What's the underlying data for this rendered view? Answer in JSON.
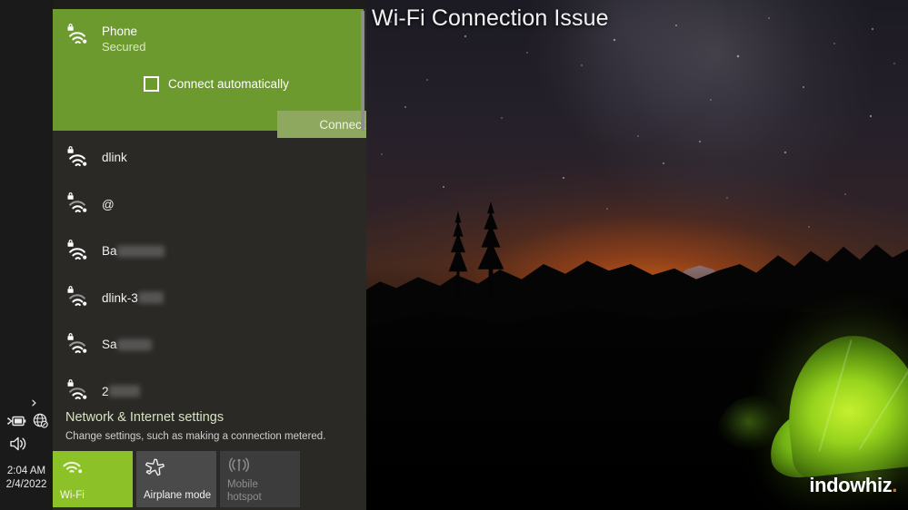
{
  "window": {
    "title": "Wi-Fi Connection Issue",
    "watermark": "indowhiz",
    "watermark_dot": "."
  },
  "colors": {
    "selected_network_green": "#6d9a2e",
    "wifi_tile_green": "#8cc227",
    "panel_dark": "#2b2926",
    "taskbar_dark": "#1a1a1a",
    "connect_button": "#8ea85f",
    "settings_link": "#d6e3c2",
    "watermark_accent": "#f26a21"
  },
  "taskbar": {
    "chevron_icon": "chevron-right-icon",
    "battery_icon": "battery-charging-icon",
    "network_icon": "globe-no-internet-icon",
    "volume_icon": "speaker-volume-icon",
    "clock_time": "2:04 AM",
    "clock_date": "2/4/2022"
  },
  "network_panel": {
    "selected": {
      "ssid": "Phone",
      "status": "Secured",
      "signal_icon": "wifi-secured-icon",
      "auto_connect_label": "Connect automatically",
      "auto_connect_checked": false,
      "connect_label": "Connect"
    },
    "networks": [
      {
        "ssid": "dlink",
        "icon": "wifi-secured-icon",
        "redaction_width": 0
      },
      {
        "ssid": "@",
        "icon": "wifi-secured-icon",
        "redaction_width": 0
      },
      {
        "ssid": "Ba",
        "icon": "wifi-secured-icon",
        "redaction_width": 52
      },
      {
        "ssid": "dlink-3",
        "icon": "wifi-secured-icon",
        "redaction_width": 28
      },
      {
        "ssid": "Sa",
        "icon": "wifi-secured-icon",
        "redaction_width": 38
      },
      {
        "ssid": "2",
        "icon": "wifi-secured-icon",
        "redaction_width": 34
      }
    ],
    "settings": {
      "link": "Network & Internet settings",
      "description": "Change settings, such as making a connection metered."
    },
    "quick_actions": [
      {
        "label": "Wi-Fi",
        "icon": "wifi-icon",
        "state": "active"
      },
      {
        "label": "Airplane mode",
        "icon": "airplane-icon",
        "state": "inactive"
      },
      {
        "label": "Mobile\nhotspot",
        "icon": "mobile-hotspot-icon",
        "state": "disabled",
        "label_line1": "Mobile",
        "label_line2": "hotspot"
      }
    ]
  }
}
